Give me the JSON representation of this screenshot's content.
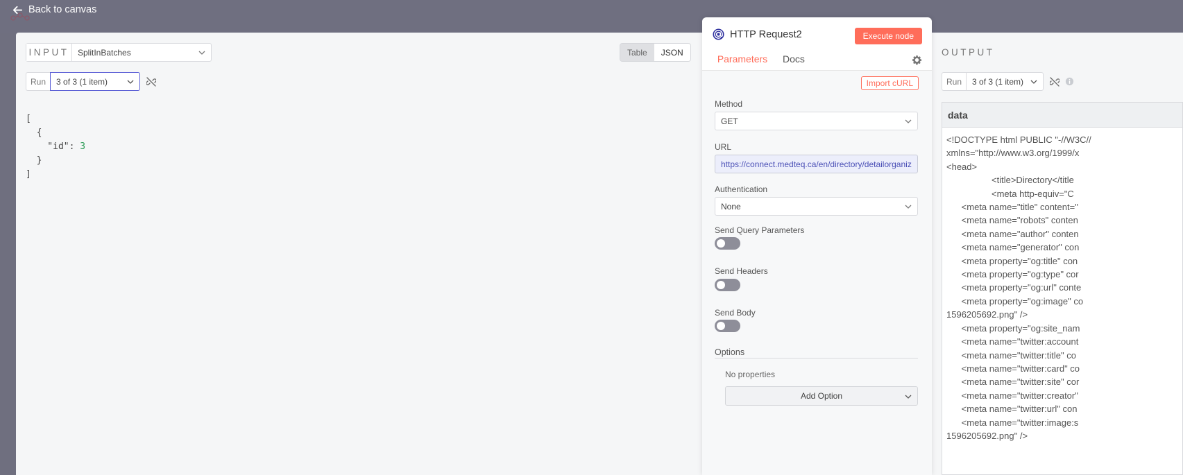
{
  "topbar": {
    "back_label": "Back to canvas"
  },
  "input": {
    "title": "INPUT",
    "node_select": "SplitInBatches",
    "view_table": "Table",
    "view_json": "JSON",
    "run_label": "Run",
    "run_select": "3 of 3 (1 item)",
    "json_lines": [
      "[",
      "  {",
      "    \"id\": ",
      "  }",
      "]"
    ],
    "json_value": "3"
  },
  "params": {
    "node_title": "HTTP Request2",
    "execute_label": "Execute node",
    "tab_parameters": "Parameters",
    "tab_docs": "Docs",
    "import_curl": "Import cURL",
    "method_label": "Method",
    "method_value": "GET",
    "url_label": "URL",
    "url_value": "https://connect.medteq.ca/en/directory/detailorganization",
    "auth_label": "Authentication",
    "auth_value": "None",
    "send_query_label": "Send Query Parameters",
    "send_headers_label": "Send Headers",
    "send_body_label": "Send Body",
    "options_title": "Options",
    "no_properties": "No properties",
    "add_option": "Add Option"
  },
  "output": {
    "title": "OUTPUT",
    "run_label": "Run",
    "run_select": "3 of 3 (1 item)",
    "data_header": "data",
    "lines": [
      "<!DOCTYPE html PUBLIC \"-//W3C//",
      "xmlns=\"http://www.w3.org/1999/x",
      "<head>",
      "                  <title>Directory</title",
      "                  <meta http-equiv=\"C",
      "      <meta name=\"title\" content=\"",
      "      <meta name=\"robots\" conten",
      "      <meta name=\"author\" conten",
      "      <meta name=\"generator\" con",
      "      <meta property=\"og:title\" con",
      "      <meta property=\"og:type\" cor",
      "      <meta property=\"og:url\" conte",
      "      <meta property=\"og:image\" co",
      "1596205692.png\" />",
      "      <meta property=\"og:site_nam",
      "      <meta name=\"twitter:account",
      "      <meta name=\"twitter:title\" co",
      "      <meta name=\"twitter:card\" co",
      "      <meta name=\"twitter:site\" cor",
      "      <meta name=\"twitter:creator\"",
      "      <meta name=\"twitter:url\" con",
      "      <meta name=\"twitter:image:s",
      "1596205692.png\" />"
    ]
  },
  "colors": {
    "accent": "#ff6d5a",
    "focus": "#5b5fd6",
    "backdrop": "#6f6f80"
  }
}
